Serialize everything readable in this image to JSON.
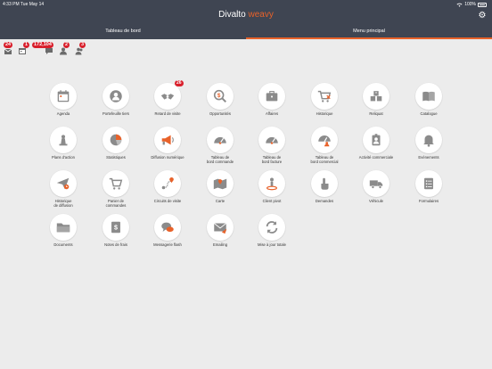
{
  "status_bar": {
    "time": "4:33 PM  Tue May 14",
    "wifi": "wifi-icon",
    "battery_text": "100%"
  },
  "brand": {
    "part1": "Divalto",
    "part2": " weavy"
  },
  "tabs": [
    {
      "label": "Tableau de bord"
    },
    {
      "label": "Menu principal",
      "active": true
    }
  ],
  "notifications": [
    {
      "icon": "message-icon",
      "count": "24"
    },
    {
      "icon": "calendar-icon",
      "count": "1"
    },
    {
      "icon": "chat-icon",
      "count": "172,104"
    },
    {
      "icon": "person-icon",
      "count": "2"
    },
    {
      "icon": "users-icon",
      "count": "3"
    }
  ],
  "menu": {
    "items": [
      {
        "label": "Agenda",
        "icon": "agenda-icon"
      },
      {
        "label": "Portefeuille tiers",
        "icon": "portfolio-icon"
      },
      {
        "label": "Retard de visite",
        "icon": "handshake-icon",
        "badge": "26"
      },
      {
        "label": "Opportunités",
        "icon": "opportunity-icon"
      },
      {
        "label": "Affaires",
        "icon": "briefcase-icon"
      },
      {
        "label": "Historique",
        "icon": "cart-history-icon"
      },
      {
        "label": "Reliquat",
        "icon": "boxes-icon"
      },
      {
        "label": "Catalogue",
        "icon": "book-icon"
      },
      {
        "label": "Plans d'action",
        "icon": "chess-icon"
      },
      {
        "label": "Statistiques",
        "icon": "pie-chart-icon"
      },
      {
        "label": "Diffusion numérique",
        "icon": "megaphone-icon"
      },
      {
        "label": "Tableau de\nbord commande",
        "icon": "gauge-icon"
      },
      {
        "label": "Tableau de\nbord facture",
        "icon": "gauge-icon"
      },
      {
        "label": "Tableau de\nbord commercial",
        "icon": "gauge-people-icon"
      },
      {
        "label": "Activité commerciale",
        "icon": "id-badge-icon"
      },
      {
        "label": "Evénements",
        "icon": "bell-icon"
      },
      {
        "label": "Historique\nde diffusion",
        "icon": "send-history-icon"
      },
      {
        "label": "Panier de\ncommandes",
        "icon": "cart-icon"
      },
      {
        "label": "Circuits de visite",
        "icon": "route-icon"
      },
      {
        "label": "Carte",
        "icon": "map-icon"
      },
      {
        "label": "Client pivot",
        "icon": "pivot-client-icon"
      },
      {
        "label": "Demandes",
        "icon": "hand-pointer-icon"
      },
      {
        "label": "Véhicule",
        "icon": "truck-icon"
      },
      {
        "label": "Formulaires",
        "icon": "form-icon"
      },
      {
        "label": "Documents",
        "icon": "folder-icon"
      },
      {
        "label": "Notes de frais",
        "icon": "expense-icon"
      },
      {
        "label": "Messagerie flash",
        "icon": "chat-bubbles-icon"
      },
      {
        "label": "Emailing",
        "icon": "email-icon"
      },
      {
        "label": "Mise à jour totale",
        "icon": "sync-icon"
      }
    ]
  },
  "colors": {
    "header": "#3f4552",
    "accent": "#e8622a",
    "badge": "#d9202c",
    "icon_gray": "#8b8b8b",
    "icon_orange": "#e8622a"
  }
}
